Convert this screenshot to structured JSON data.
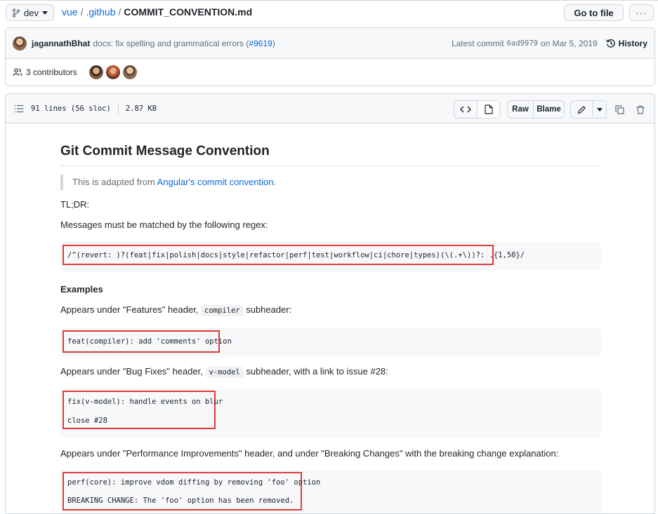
{
  "topbar": {
    "branch": "dev",
    "repo": "vue",
    "folder": ".github",
    "file": "COMMIT_CONVENTION.md",
    "sep": "/",
    "goto_label": "Go to file",
    "more_label": "···"
  },
  "commit": {
    "author": "jagannathBhat",
    "message": "docs: fix spelling and grammatical errors (",
    "issue": "#9619",
    "message_end": ")",
    "latest_label": "Latest commit",
    "sha": "6ad9979",
    "date": "on Mar 5, 2019",
    "history_label": "History"
  },
  "contributors": {
    "label": "3 contributors"
  },
  "file": {
    "lines": "91 lines (56 sloc)",
    "size": "2.87 KB",
    "raw_label": "Raw",
    "blame_label": "Blame"
  },
  "doc": {
    "title": "Git Commit Message Convention",
    "quote_prefix": "This is adapted from ",
    "quote_link": "Angular's commit convention",
    "quote_suffix": ".",
    "tldr": "TL;DR:",
    "regex_intro": "Messages must be matched by the following regex:",
    "regex": "/^(revert: )?(feat|fix|polish|docs|style|refactor|perf|test|workflow|ci|chore|types)(\\(.+\\))?: .{1,50}/",
    "examples_heading": "Examples",
    "ex1_before": "Appears under \"Features\" header, ",
    "ex1_code": "compiler",
    "ex1_after": " subheader:",
    "ex1_block": [
      "feat(compiler): add 'comments' option"
    ],
    "ex2_before": "Appears under \"Bug Fixes\" header, ",
    "ex2_code": "v-model",
    "ex2_after": " subheader, with a link to issue #28:",
    "ex2_block": [
      "fix(v-model): handle events on blur",
      "close #28"
    ],
    "ex3_text": "Appears under \"Performance Improvements\" header, and under \"Breaking Changes\" with the breaking change explanation:",
    "ex3_block": [
      "perf(core): improve vdom diffing by removing 'foo' option",
      "BREAKING CHANGE: The 'foo' option has been removed."
    ]
  },
  "colors": {
    "link": "#0969da",
    "highlight": "#e23a3a",
    "code_bg": "#f6f8fa"
  }
}
